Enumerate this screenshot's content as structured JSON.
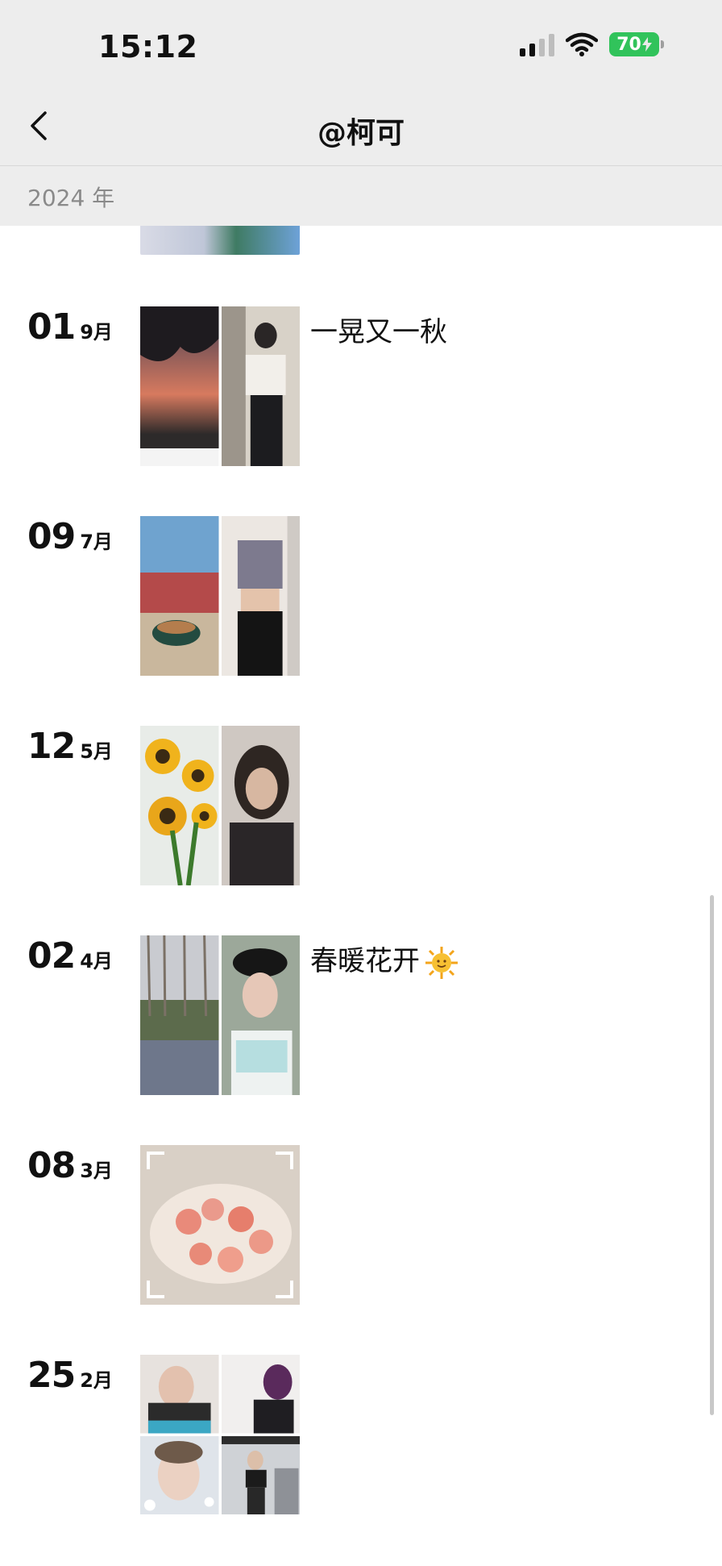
{
  "status": {
    "time": "15:12",
    "battery": "70"
  },
  "nav": {
    "title": "@柯可"
  },
  "year_label": "2024 年",
  "entries": [
    {
      "day": "01",
      "month": "9月",
      "caption": "一晃又一秋"
    },
    {
      "day": "09",
      "month": "7月",
      "caption": ""
    },
    {
      "day": "12",
      "month": "5月",
      "caption": ""
    },
    {
      "day": "02",
      "month": "4月",
      "caption": "春暖花开"
    },
    {
      "day": "08",
      "month": "3月",
      "caption": ""
    },
    {
      "day": "25",
      "month": "2月",
      "caption": ""
    }
  ],
  "icons": {
    "back": "chevron-left-icon",
    "signal": "signal-icon",
    "wifi": "wifi-icon",
    "battery": "battery-icon",
    "sun": "sun-emoji"
  },
  "colors": {
    "header_bg": "#ededed",
    "battery_green": "#31c35b",
    "year_text": "#8a8a8a"
  }
}
